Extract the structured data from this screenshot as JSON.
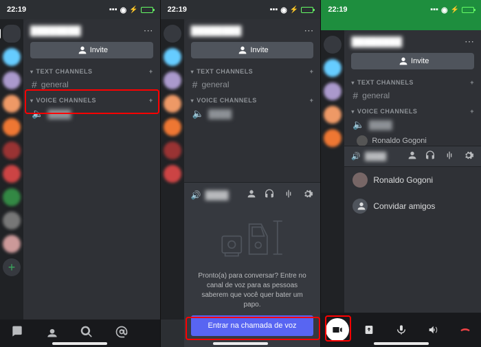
{
  "shared": {
    "time": "22:19",
    "server_name_blurred": "████████",
    "invite_label": "Invite",
    "text_channels_label": "TEXT CHANNELS",
    "voice_channels_label": "VOICE CHANNELS",
    "general_channel": "general",
    "voice_channel_blurred": "████"
  },
  "s2": {
    "prompt_text": "Pronto(a) para conversar? Entre no canal de voz para as pessoas saberem que você quer bater um papo.",
    "join_button": "Entrar na chamada de voz"
  },
  "s3": {
    "member_name": "Ronaldo Gogoni",
    "invite_friends": "Convidar amigos"
  }
}
